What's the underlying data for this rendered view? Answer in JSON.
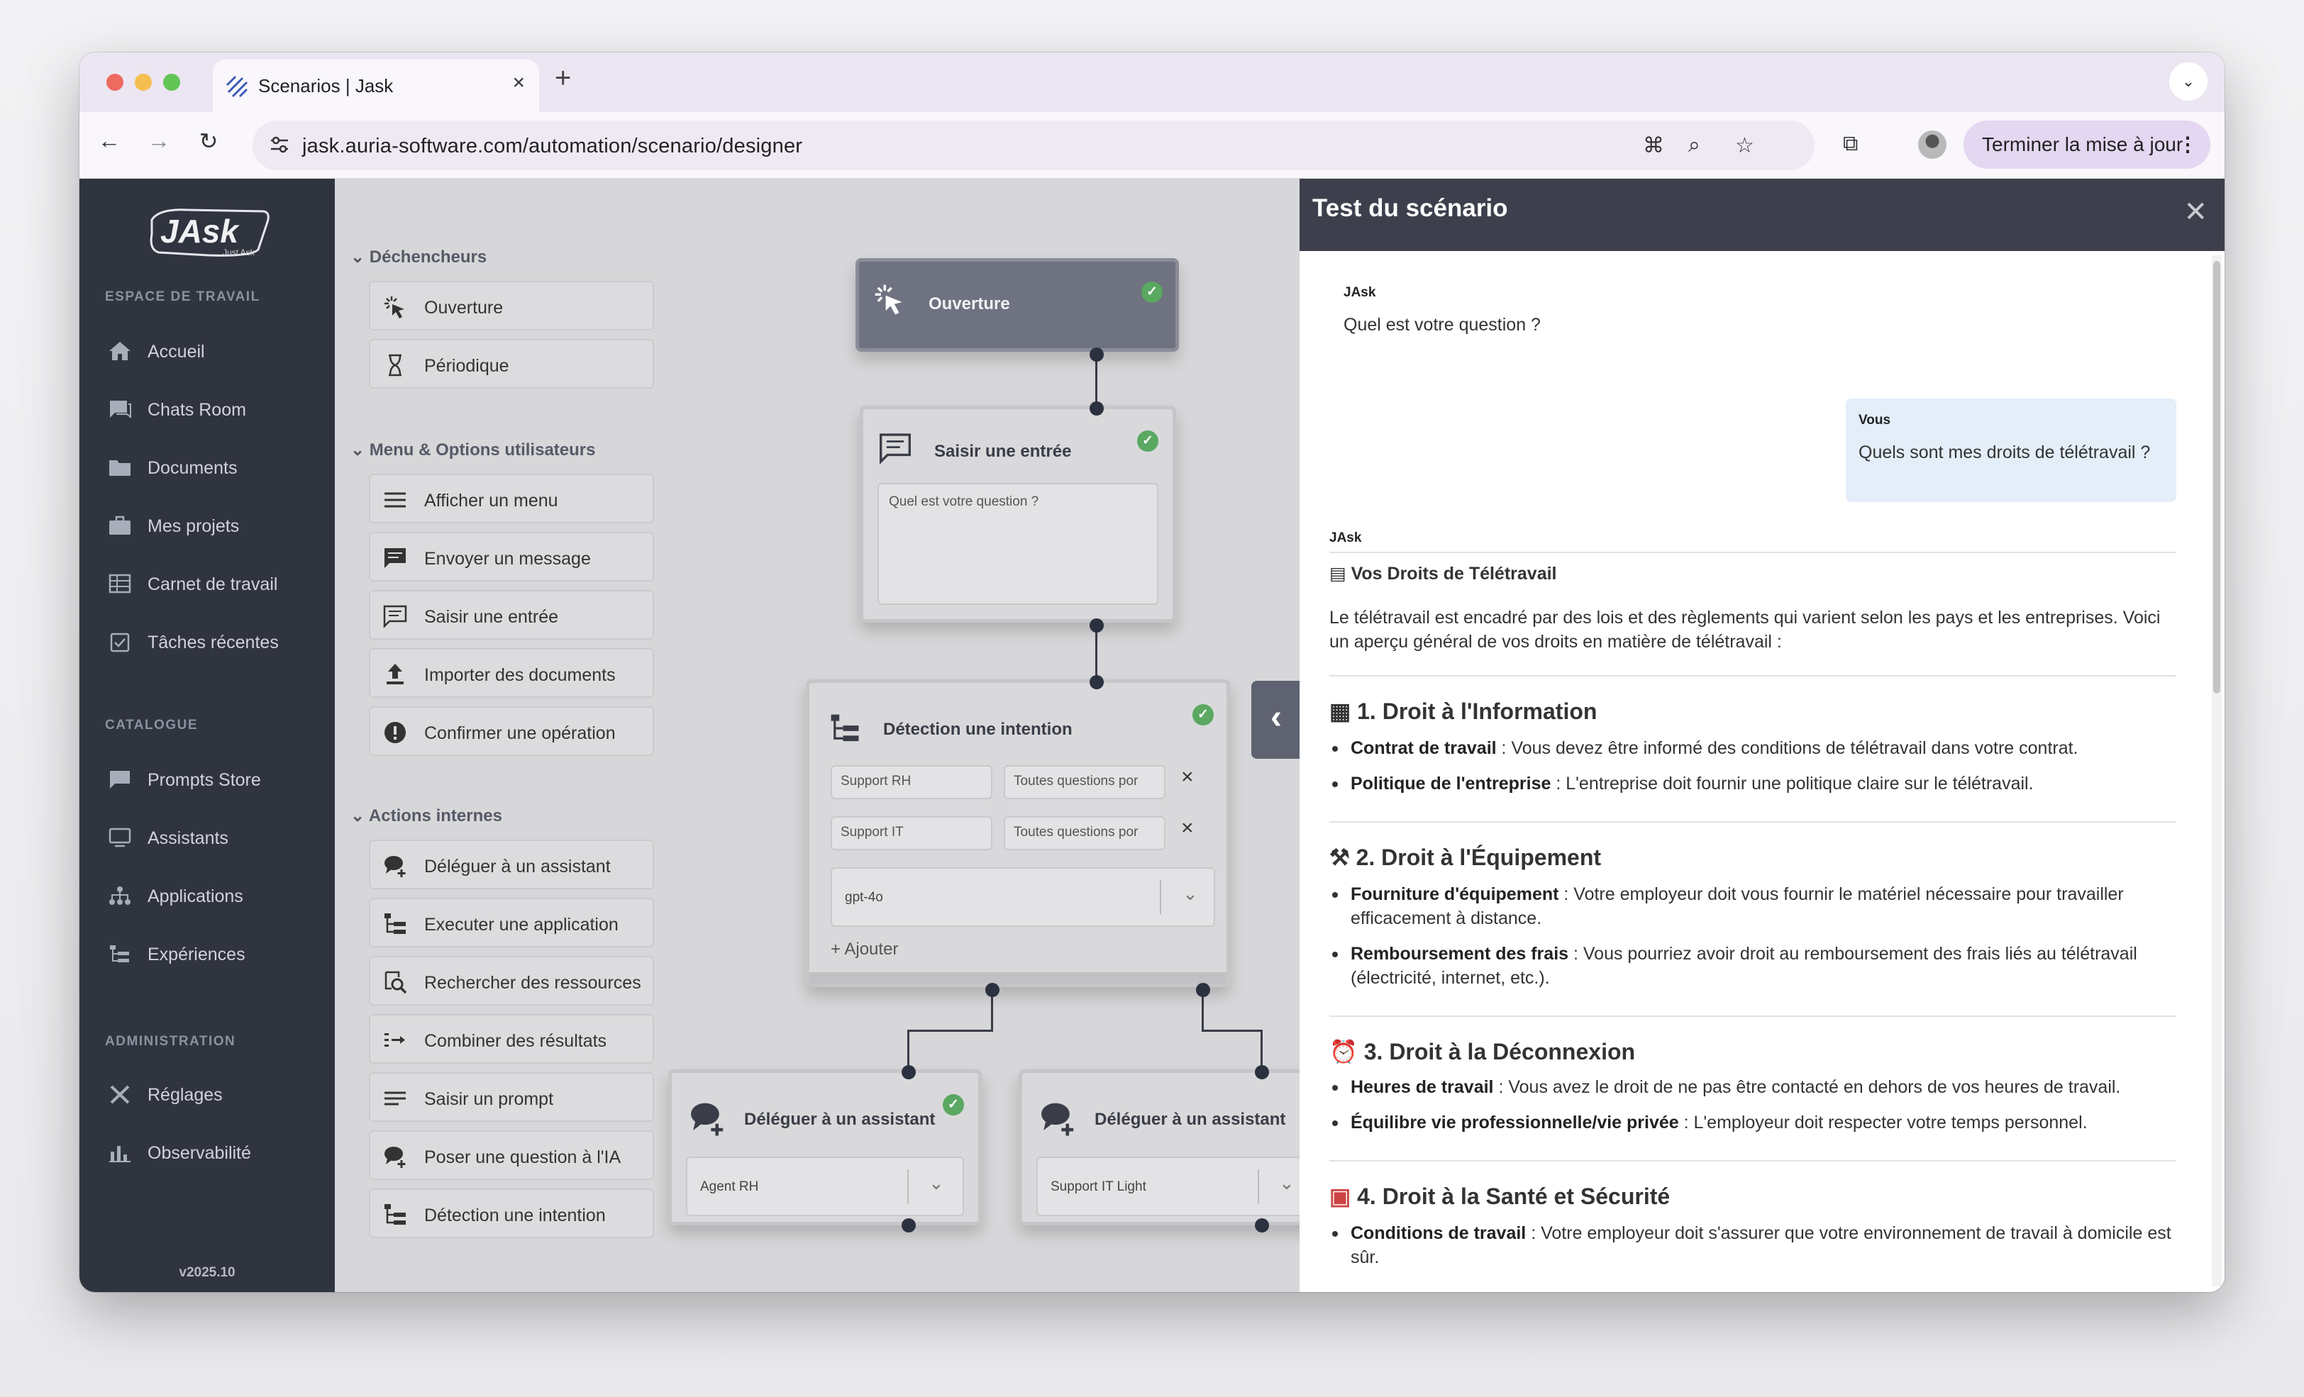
{
  "browser": {
    "tab_title": "Scenarios | Jask",
    "url": "jask.auria-software.com/automation/scenario/designer",
    "update_button": "Terminer la mise à jour"
  },
  "sidebar": {
    "logo_text": "JAsk",
    "logo_tagline": "Just Ask",
    "section_workspace": "ESPACE DE TRAVAIL",
    "section_catalog": "CATALOGUE",
    "section_admin": "ADMINISTRATION",
    "workspace_items": [
      "Accueil",
      "Chats Room",
      "Documents",
      "Mes projets",
      "Carnet de travail",
      "Tâches récentes"
    ],
    "catalog_items": [
      "Prompts Store",
      "Assistants",
      "Applications",
      "Expériences"
    ],
    "admin_items": [
      "Réglages",
      "Observabilité"
    ],
    "version": "v2025.10"
  },
  "palette": {
    "group_triggers": "Déchencheurs",
    "triggers": [
      "Ouverture",
      "Périodique"
    ],
    "group_menu": "Menu & Options utilisateurs",
    "menu_items": [
      "Afficher un menu",
      "Envoyer un message",
      "Saisir une entrée",
      "Importer des documents",
      "Confirmer une opération"
    ],
    "group_actions": "Actions internes",
    "action_items": [
      "Déléguer à un assistant",
      "Executer une application",
      "Rechercher des ressources",
      "Combiner des résultats",
      "Saisir un prompt",
      "Poser une question à l'IA",
      "Détection une intention"
    ]
  },
  "flow": {
    "opening_title": "Ouverture",
    "input_title": "Saisir une entrée",
    "input_value": "Quel est votre question ?",
    "intent_title": "Détection une intention",
    "intent_rows": [
      {
        "name": "Support RH",
        "desc": "Toutes questions por"
      },
      {
        "name": "Support IT",
        "desc": "Toutes questions por"
      }
    ],
    "intent_model": "gpt-4o",
    "intent_add": "+ Ajouter",
    "delegate1_title": "Déléguer à un assistant",
    "delegate1_value": "Agent RH",
    "delegate2_title": "Déléguer à un assistant",
    "delegate2_value": "Support IT Light"
  },
  "test_panel": {
    "title": "Test du scénario",
    "bot_name": "JAsk",
    "bot_question": "Quel est votre question ?",
    "user_name": "Vous",
    "user_message": "Quels sont mes droits de télétravail ?",
    "bot_name2": "JAsk",
    "answer_title": "Vos Droits de Télétravail",
    "intro": "Le télétravail est encadré par des lois et des règlements qui varient selon les pays et les entreprises. Voici un aperçu général de vos droits en matière de télétravail :",
    "sections": [
      {
        "title": "1. Droit à l'Information",
        "items": [
          {
            "bold": "Contrat de travail",
            "text": " : Vous devez être informé des conditions de télétravail dans votre contrat."
          },
          {
            "bold": "Politique de l'entreprise",
            "text": " : L'entreprise doit fournir une politique claire sur le télétravail."
          }
        ]
      },
      {
        "title": "2. Droit à l'Équipement",
        "items": [
          {
            "bold": "Fourniture d'équipement",
            "text": " : Votre employeur doit vous fournir le matériel nécessaire pour travailler efficacement à distance."
          },
          {
            "bold": "Remboursement des frais",
            "text": " : Vous pourriez avoir droit au remboursement des frais liés au télétravail (électricité, internet, etc.)."
          }
        ]
      },
      {
        "title": "3. Droit à la Déconnexion",
        "items": [
          {
            "bold": "Heures de travail",
            "text": " : Vous avez le droit de ne pas être contacté en dehors de vos heures de travail."
          },
          {
            "bold": "Équilibre vie professionnelle/vie privée",
            "text": " : L'employeur doit respecter votre temps personnel."
          }
        ]
      },
      {
        "title": "4. Droit à la Santé et Sécurité",
        "items": [
          {
            "bold": "Conditions de travail",
            "text": " : Votre employeur doit s'assurer que votre environnement de travail à domicile est sûr."
          }
        ]
      }
    ]
  },
  "colors": {
    "sidebar_bg": "#30343f",
    "panel_header_bg": "#3d404c",
    "check_green": "#5aa862",
    "user_bubble": "#e3eef9",
    "update_btn": "#e4d7f1"
  },
  "icons": {
    "tab": "jask-favicon-icon",
    "opening": "cursor-click-icon",
    "periodic": "hourglass-icon",
    "menu": "menu-lines-icon",
    "message": "message-icon",
    "input": "chat-input-icon",
    "import": "upload-icon",
    "confirm": "alert-circle-icon",
    "delegate": "chat-add-icon",
    "execute": "tree-icon",
    "search": "search-doc-icon",
    "combine": "combine-icon",
    "prompt": "lines-icon",
    "ask_ai": "chat-add-icon",
    "intent": "tree-icon"
  }
}
